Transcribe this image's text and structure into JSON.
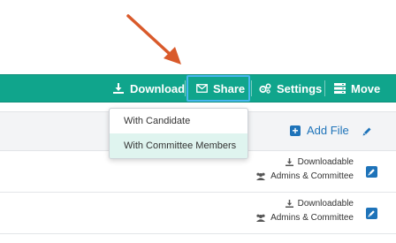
{
  "toolbar": {
    "download_label": "Download",
    "share_label": "Share",
    "settings_label": "Settings",
    "move_label": "Move",
    "bg_color": "#10a58c",
    "share_highlight_color": "#47b7f0"
  },
  "subbar": {
    "add_file_label": "Add File"
  },
  "share_menu": {
    "items": [
      {
        "label": "With Candidate",
        "active": false
      },
      {
        "label": "With Committee Members",
        "active": true
      }
    ]
  },
  "files": [
    {
      "status": "Downloadable",
      "visibility": "Admins & Committee"
    },
    {
      "status": "Downloadable",
      "visibility": "Admins & Committee"
    }
  ],
  "annotation": {
    "arrow_color": "#d95a2b",
    "target": "share-button"
  },
  "icons": {
    "download": "download-icon",
    "share": "envelope-icon",
    "settings": "gears-icon",
    "move": "server-icon",
    "add": "plus-square-icon",
    "edit": "pencil-icon",
    "users": "users-icon"
  }
}
